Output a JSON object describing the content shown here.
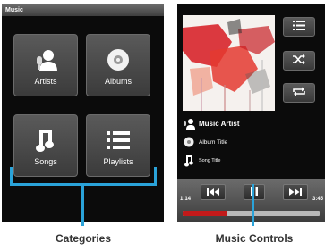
{
  "left_screen": {
    "status_title": "Music",
    "categories": [
      {
        "label": "Artists",
        "icon": "artist-icon"
      },
      {
        "label": "Albums",
        "icon": "album-disc-icon"
      },
      {
        "label": "Songs",
        "icon": "music-note-icon"
      },
      {
        "label": "Playlists",
        "icon": "playlist-icon"
      }
    ]
  },
  "right_screen": {
    "side_buttons": [
      {
        "icon": "list-icon"
      },
      {
        "icon": "shuffle-icon"
      },
      {
        "icon": "repeat-icon"
      }
    ],
    "artist": "Music Artist",
    "album": "Album Title",
    "song": "Song Title",
    "elapsed": "1:14",
    "duration": "3:45",
    "progress": 0.33,
    "controls": [
      {
        "icon": "previous-icon"
      },
      {
        "icon": "pause-icon"
      },
      {
        "icon": "next-icon"
      }
    ]
  },
  "callouts": {
    "left": "Categories",
    "right": "Music Controls"
  },
  "colors": {
    "callout": "#2aa3d9",
    "progress": "#c21a1a"
  }
}
